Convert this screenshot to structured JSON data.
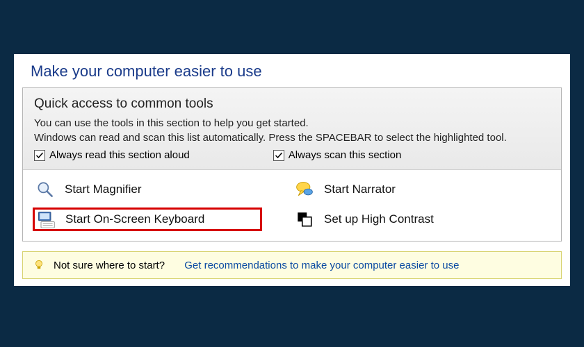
{
  "page": {
    "title": "Make your computer easier to use"
  },
  "quick_access": {
    "heading": "Quick access to common tools",
    "line1": "You can use the tools in this section to help you get started.",
    "line2": "Windows can read and scan this list automatically.  Press the SPACEBAR to select the highlighted tool.",
    "checkbox_read": "Always read this section aloud",
    "checkbox_scan": "Always scan this section"
  },
  "tools": {
    "magnifier": "Start Magnifier",
    "narrator": "Start Narrator",
    "osk": "Start On-Screen Keyboard",
    "highcontrast": "Set up High Contrast"
  },
  "tip": {
    "lead": "Not sure where to start?",
    "link": "Get recommendations to make your computer easier to use"
  }
}
